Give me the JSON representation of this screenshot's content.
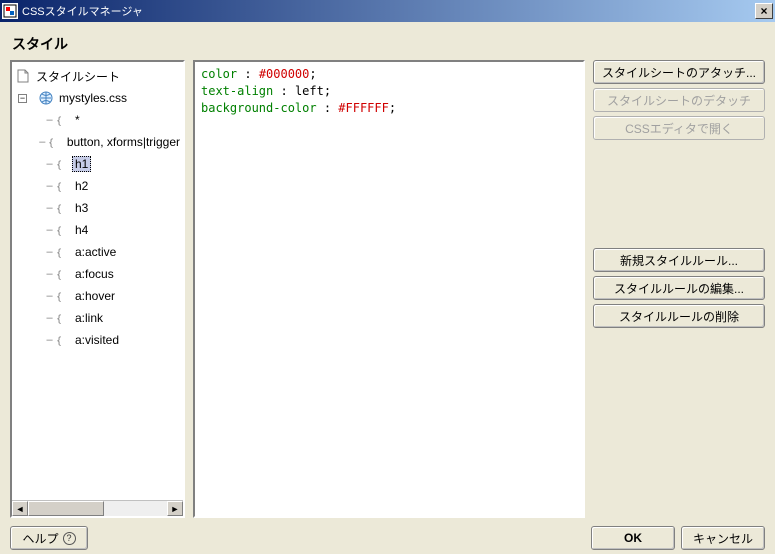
{
  "window": {
    "title": "CSSスタイルマネージャ",
    "close": "×"
  },
  "heading": "スタイル",
  "tree": {
    "root": "スタイルシート",
    "file": "mystyles.css",
    "rules": [
      "*",
      "button, xforms|trigger",
      "h1",
      "h2",
      "h3",
      "h4",
      "a:active",
      "a:focus",
      "a:hover",
      "a:link",
      "a:visited"
    ],
    "selected_rule_index": 2
  },
  "detail": {
    "lines": [
      {
        "prop": "color",
        "value": "#000000",
        "value_kind": "color"
      },
      {
        "prop": "text-align",
        "value": "left",
        "value_kind": "plain"
      },
      {
        "prop": "background-color",
        "value": "#FFFFFF",
        "value_kind": "color"
      }
    ]
  },
  "sidebuttons": {
    "attach": "スタイルシートのアタッチ...",
    "detach": "スタイルシートのデタッチ",
    "open_editor": "CSSエディタで開く",
    "new_rule": "新規スタイルルール...",
    "edit_rule": "スタイルルールの編集...",
    "delete_rule": "スタイルルールの削除"
  },
  "bottom": {
    "help": "ヘルプ",
    "ok": "OK",
    "cancel": "キャンセル"
  },
  "scroll": {
    "left": "◄",
    "right": "►"
  }
}
